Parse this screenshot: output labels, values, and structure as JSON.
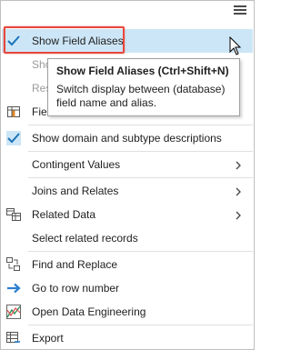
{
  "menu": {
    "items": [
      {
        "label": "Show Field Aliases",
        "icon": "checkmark-icon"
      },
      {
        "label": "Sho"
      },
      {
        "label": "Res"
      },
      {
        "label": "Fiel",
        "icon": "fields-table-icon"
      },
      {
        "label": "Show domain and subtype descriptions",
        "icon": "checkmark-icon"
      },
      {
        "label": "Contingent Values"
      },
      {
        "label": "Joins and Relates"
      },
      {
        "label": "Related Data",
        "icon": "related-tables-icon"
      },
      {
        "label": "Select related records"
      },
      {
        "label": "Find and Replace",
        "icon": "find-replace-icon"
      },
      {
        "label": "Go to row number",
        "icon": "arrow-right-icon"
      },
      {
        "label": "Open Data Engineering",
        "icon": "data-engineering-icon"
      },
      {
        "label": "Export",
        "icon": "export-table-icon"
      }
    ]
  },
  "tooltip": {
    "title": "Show Field Aliases (Ctrl+Shift+N)",
    "body": "Switch display between (database) field name and alias."
  },
  "colors": {
    "selected_bg": "#cde6f7",
    "check": "#1a73b8",
    "callout_border": "#e8463b"
  }
}
